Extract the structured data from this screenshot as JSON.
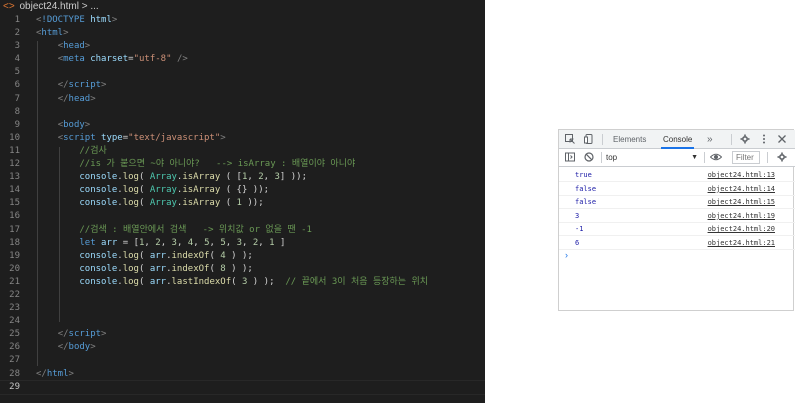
{
  "breadcrumb": {
    "file": "object24.html",
    "rest": "> ..."
  },
  "editor_lines": [
    {
      "n": "1",
      "tokens": [
        [
          "brk",
          "<"
        ],
        [
          "tag",
          "!DOCTYPE"
        ],
        [
          "txt",
          " "
        ],
        [
          "attr",
          "html"
        ],
        [
          "brk",
          ">"
        ]
      ]
    },
    {
      "n": "2",
      "tokens": [
        [
          "brk",
          "<"
        ],
        [
          "tag",
          "html"
        ],
        [
          "brk",
          ">"
        ]
      ]
    },
    {
      "n": "3",
      "tokens": [
        [
          "txt",
          "    "
        ],
        [
          "brk",
          "<"
        ],
        [
          "tag",
          "head"
        ],
        [
          "brk",
          ">"
        ]
      ]
    },
    {
      "n": "4",
      "tokens": [
        [
          "txt",
          "    "
        ],
        [
          "brk",
          "<"
        ],
        [
          "tag",
          "meta"
        ],
        [
          "txt",
          " "
        ],
        [
          "attr",
          "charset"
        ],
        [
          "txt",
          "="
        ],
        [
          "str",
          "\"utf-8\""
        ],
        [
          "txt",
          " "
        ],
        [
          "brk",
          "/>"
        ]
      ]
    },
    {
      "n": "5",
      "tokens": []
    },
    {
      "n": "6",
      "tokens": [
        [
          "txt",
          "    "
        ],
        [
          "brk",
          "</"
        ],
        [
          "tag",
          "script"
        ],
        [
          "brk",
          ">"
        ]
      ]
    },
    {
      "n": "7",
      "tokens": [
        [
          "txt",
          "    "
        ],
        [
          "brk",
          "</"
        ],
        [
          "tag",
          "head"
        ],
        [
          "brk",
          ">"
        ]
      ]
    },
    {
      "n": "8",
      "tokens": []
    },
    {
      "n": "9",
      "tokens": [
        [
          "txt",
          "    "
        ],
        [
          "brk",
          "<"
        ],
        [
          "tag",
          "body"
        ],
        [
          "brk",
          ">"
        ]
      ]
    },
    {
      "n": "10",
      "tokens": [
        [
          "txt",
          "    "
        ],
        [
          "brk",
          "<"
        ],
        [
          "tag",
          "script"
        ],
        [
          "txt",
          " "
        ],
        [
          "attr",
          "type"
        ],
        [
          "txt",
          "="
        ],
        [
          "str",
          "\"text/javascript\""
        ],
        [
          "brk",
          ">"
        ]
      ]
    },
    {
      "n": "11",
      "tokens": [
        [
          "txt",
          "        "
        ],
        [
          "cmt",
          "//검사"
        ]
      ]
    },
    {
      "n": "12",
      "tokens": [
        [
          "txt",
          "        "
        ],
        [
          "cmt",
          "//is 가 붙으면 ~야 아니야?   --> isArray : 배열이야 아니야"
        ]
      ]
    },
    {
      "n": "13",
      "tokens": [
        [
          "txt",
          "        "
        ],
        [
          "var",
          "console"
        ],
        [
          "txt",
          "."
        ],
        [
          "fn",
          "log"
        ],
        [
          "txt",
          "( "
        ],
        [
          "obj",
          "Array"
        ],
        [
          "txt",
          "."
        ],
        [
          "fn",
          "isArray"
        ],
        [
          "txt",
          " ( ["
        ],
        [
          "num-l",
          "1"
        ],
        [
          "txt",
          ", "
        ],
        [
          "num-l",
          "2"
        ],
        [
          "txt",
          ", "
        ],
        [
          "num-l",
          "3"
        ],
        [
          "txt",
          "] ));"
        ]
      ]
    },
    {
      "n": "14",
      "tokens": [
        [
          "txt",
          "        "
        ],
        [
          "var",
          "console"
        ],
        [
          "txt",
          "."
        ],
        [
          "fn",
          "log"
        ],
        [
          "txt",
          "( "
        ],
        [
          "obj",
          "Array"
        ],
        [
          "txt",
          "."
        ],
        [
          "fn",
          "isArray"
        ],
        [
          "txt",
          " ( {} ));"
        ]
      ]
    },
    {
      "n": "15",
      "tokens": [
        [
          "txt",
          "        "
        ],
        [
          "var",
          "console"
        ],
        [
          "txt",
          "."
        ],
        [
          "fn",
          "log"
        ],
        [
          "txt",
          "( "
        ],
        [
          "obj",
          "Array"
        ],
        [
          "txt",
          "."
        ],
        [
          "fn",
          "isArray"
        ],
        [
          "txt",
          " ( "
        ],
        [
          "num-l",
          "1"
        ],
        [
          "txt",
          " ));"
        ]
      ]
    },
    {
      "n": "16",
      "tokens": []
    },
    {
      "n": "17",
      "tokens": [
        [
          "txt",
          "        "
        ],
        [
          "cmt",
          "//검색 : 배열안에서 검색   -> 위치값 or 없을 땐 -1"
        ]
      ]
    },
    {
      "n": "18",
      "tokens": [
        [
          "txt",
          "        "
        ],
        [
          "kw",
          "let"
        ],
        [
          "txt",
          " "
        ],
        [
          "var",
          "arr"
        ],
        [
          "txt",
          " = ["
        ],
        [
          "num-l",
          "1"
        ],
        [
          "txt",
          ", "
        ],
        [
          "num-l",
          "2"
        ],
        [
          "txt",
          ", "
        ],
        [
          "num-l",
          "3"
        ],
        [
          "txt",
          ", "
        ],
        [
          "num-l",
          "4"
        ],
        [
          "txt",
          ", "
        ],
        [
          "num-l",
          "5"
        ],
        [
          "txt",
          ", "
        ],
        [
          "num-l",
          "5"
        ],
        [
          "txt",
          ", "
        ],
        [
          "num-l",
          "3"
        ],
        [
          "txt",
          ", "
        ],
        [
          "num-l",
          "2"
        ],
        [
          "txt",
          ", "
        ],
        [
          "num-l",
          "1"
        ],
        [
          "txt",
          " ]"
        ]
      ]
    },
    {
      "n": "19",
      "tokens": [
        [
          "txt",
          "        "
        ],
        [
          "var",
          "console"
        ],
        [
          "txt",
          "."
        ],
        [
          "fn",
          "log"
        ],
        [
          "txt",
          "( "
        ],
        [
          "var",
          "arr"
        ],
        [
          "txt",
          "."
        ],
        [
          "fn",
          "indexOf"
        ],
        [
          "txt",
          "( "
        ],
        [
          "num-l",
          "4"
        ],
        [
          "txt",
          " ) );"
        ]
      ]
    },
    {
      "n": "20",
      "tokens": [
        [
          "txt",
          "        "
        ],
        [
          "var",
          "console"
        ],
        [
          "txt",
          "."
        ],
        [
          "fn",
          "log"
        ],
        [
          "txt",
          "( "
        ],
        [
          "var",
          "arr"
        ],
        [
          "txt",
          "."
        ],
        [
          "fn",
          "indexOf"
        ],
        [
          "txt",
          "( "
        ],
        [
          "num-l",
          "8"
        ],
        [
          "txt",
          " ) );"
        ]
      ]
    },
    {
      "n": "21",
      "tokens": [
        [
          "txt",
          "        "
        ],
        [
          "var",
          "console"
        ],
        [
          "txt",
          "."
        ],
        [
          "fn",
          "log"
        ],
        [
          "txt",
          "( "
        ],
        [
          "var",
          "arr"
        ],
        [
          "txt",
          "."
        ],
        [
          "fn",
          "lastIndexOf"
        ],
        [
          "txt",
          "( "
        ],
        [
          "num-l",
          "3"
        ],
        [
          "txt",
          " ) );  "
        ],
        [
          "cmt",
          "// 끝에서 3이 처음 등장하는 위치"
        ]
      ]
    },
    {
      "n": "22",
      "tokens": []
    },
    {
      "n": "23",
      "tokens": []
    },
    {
      "n": "24",
      "tokens": []
    },
    {
      "n": "25",
      "tokens": [
        [
          "txt",
          "    "
        ],
        [
          "brk",
          "</"
        ],
        [
          "tag",
          "script"
        ],
        [
          "brk",
          ">"
        ]
      ]
    },
    {
      "n": "26",
      "tokens": [
        [
          "txt",
          "    "
        ],
        [
          "brk",
          "</"
        ],
        [
          "tag",
          "body"
        ],
        [
          "brk",
          ">"
        ]
      ]
    },
    {
      "n": "27",
      "tokens": []
    },
    {
      "n": "28",
      "tokens": [
        [
          "brk",
          "</"
        ],
        [
          "tag",
          "html"
        ],
        [
          "brk",
          ">"
        ]
      ]
    },
    {
      "n": "29",
      "tokens": []
    }
  ],
  "devtools": {
    "tabs": {
      "elements": "Elements",
      "console": "Console",
      "more": "»"
    },
    "context": "top",
    "filter_placeholder": "Filter",
    "prompt": "›",
    "logs": [
      {
        "value": "true",
        "kind": "bool",
        "source": "object24.html:13"
      },
      {
        "value": "false",
        "kind": "bool",
        "source": "object24.html:14"
      },
      {
        "value": "false",
        "kind": "bool",
        "source": "object24.html:15"
      },
      {
        "value": "3",
        "kind": "num",
        "source": "object24.html:19"
      },
      {
        "value": "-1",
        "kind": "num",
        "source": "object24.html:20"
      },
      {
        "value": "6",
        "kind": "num",
        "source": "object24.html:21"
      }
    ]
  },
  "colors": {
    "editor_bg": "#1e1e1e",
    "line_number": "#858585",
    "tag": "#569cd6",
    "attribute": "#9cdcfe",
    "string": "#ce9178",
    "comment": "#6a9955",
    "class": "#4ec9b0",
    "function": "#dcdcaa",
    "number": "#b5cea8",
    "devtools_accent": "#1a73e8",
    "console_value": "#1a1aa6"
  },
  "icons": [
    "html-file-icon",
    "inspect-icon",
    "device-toggle-icon",
    "settings-icon",
    "more-vert-icon",
    "close-icon",
    "sidebar-toggle-icon",
    "clear-console-icon",
    "eye-icon",
    "gear-icon"
  ]
}
